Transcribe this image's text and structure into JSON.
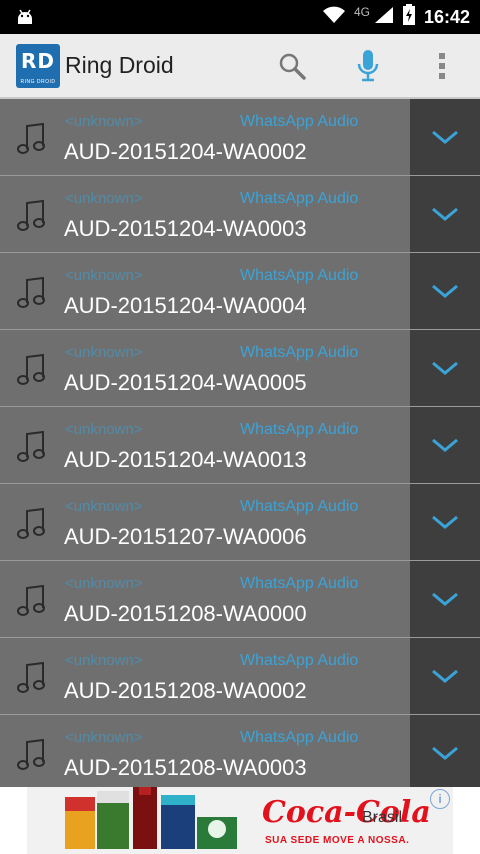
{
  "status_bar": {
    "network": "4G",
    "time": "16:42"
  },
  "header": {
    "logo_text": "RD",
    "logo_subtext": "RING DROID",
    "title": "Ring Droid"
  },
  "list": {
    "items": [
      {
        "artist": "<unknown>",
        "album": "WhatsApp Audio",
        "title": "AUD-20151204-WA0002"
      },
      {
        "artist": "<unknown>",
        "album": "WhatsApp Audio",
        "title": "AUD-20151204-WA0003"
      },
      {
        "artist": "<unknown>",
        "album": "WhatsApp Audio",
        "title": "AUD-20151204-WA0004"
      },
      {
        "artist": "<unknown>",
        "album": "WhatsApp Audio",
        "title": "AUD-20151204-WA0005"
      },
      {
        "artist": "<unknown>",
        "album": "WhatsApp Audio",
        "title": "AUD-20151204-WA0013"
      },
      {
        "artist": "<unknown>",
        "album": "WhatsApp Audio",
        "title": "AUD-20151207-WA0006"
      },
      {
        "artist": "<unknown>",
        "album": "WhatsApp Audio",
        "title": "AUD-20151208-WA0000"
      },
      {
        "artist": "<unknown>",
        "album": "WhatsApp Audio",
        "title": "AUD-20151208-WA0002"
      },
      {
        "artist": "<unknown>",
        "album": "WhatsApp Audio",
        "title": "AUD-20151208-WA0003"
      }
    ]
  },
  "ad": {
    "brand": "Coca-Cola",
    "brand_sub": "Brasil",
    "tagline": "SUA SEDE MOVE A NOSSA."
  },
  "icons": {
    "android": "android-icon",
    "search": "search-icon",
    "mic": "microphone-icon",
    "overflow": "overflow-menu-icon",
    "note": "music-note-icon",
    "chevron": "chevron-down-icon"
  },
  "colors": {
    "accent": "#3aa3d8",
    "row_bg": "#6f6f6f",
    "button_bg": "#3e3e3e",
    "status_bar": "#000000",
    "action_bar": "#ececec"
  }
}
